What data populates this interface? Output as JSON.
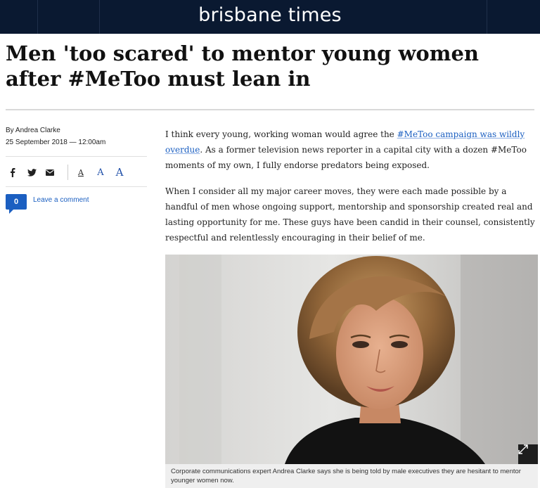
{
  "header": {
    "brand": "brisbane times"
  },
  "article": {
    "headline": "Men 'too scared' to mentor young women after #MeToo must lean in",
    "byline": "By Andrea Clarke",
    "date": "25 September 2018 — 12:00am",
    "paragraphs": {
      "p1_before": "I think every young, working woman would agree the ",
      "p1_link": "#MeToo campaign was wildly overdue",
      "p1_after": ". As a former television news reporter in a capital city with a dozen #MeToo moments of my own, I fully endorse predators being exposed.",
      "p2": "When I consider all my major career moves, they were each made possible by a handful of men whose ongoing support, mentorship and sponsorship created real and lasting opportunity for me. These guys have been candid in their counsel, consistently respectful and relentlessly encouraging in their belief of me."
    },
    "image_caption": "Corporate communications expert Andrea Clarke says she is being told by male executives they are hesitant to mentor younger women now."
  },
  "share": {
    "icons": [
      "facebook-icon",
      "twitter-icon",
      "email-icon"
    ],
    "font_sizes": [
      "A",
      "A",
      "A"
    ]
  },
  "comments": {
    "count": "0",
    "label": "Leave a comment"
  },
  "colors": {
    "header_bg": "#0a1931",
    "accent": "#1b5fc1"
  }
}
